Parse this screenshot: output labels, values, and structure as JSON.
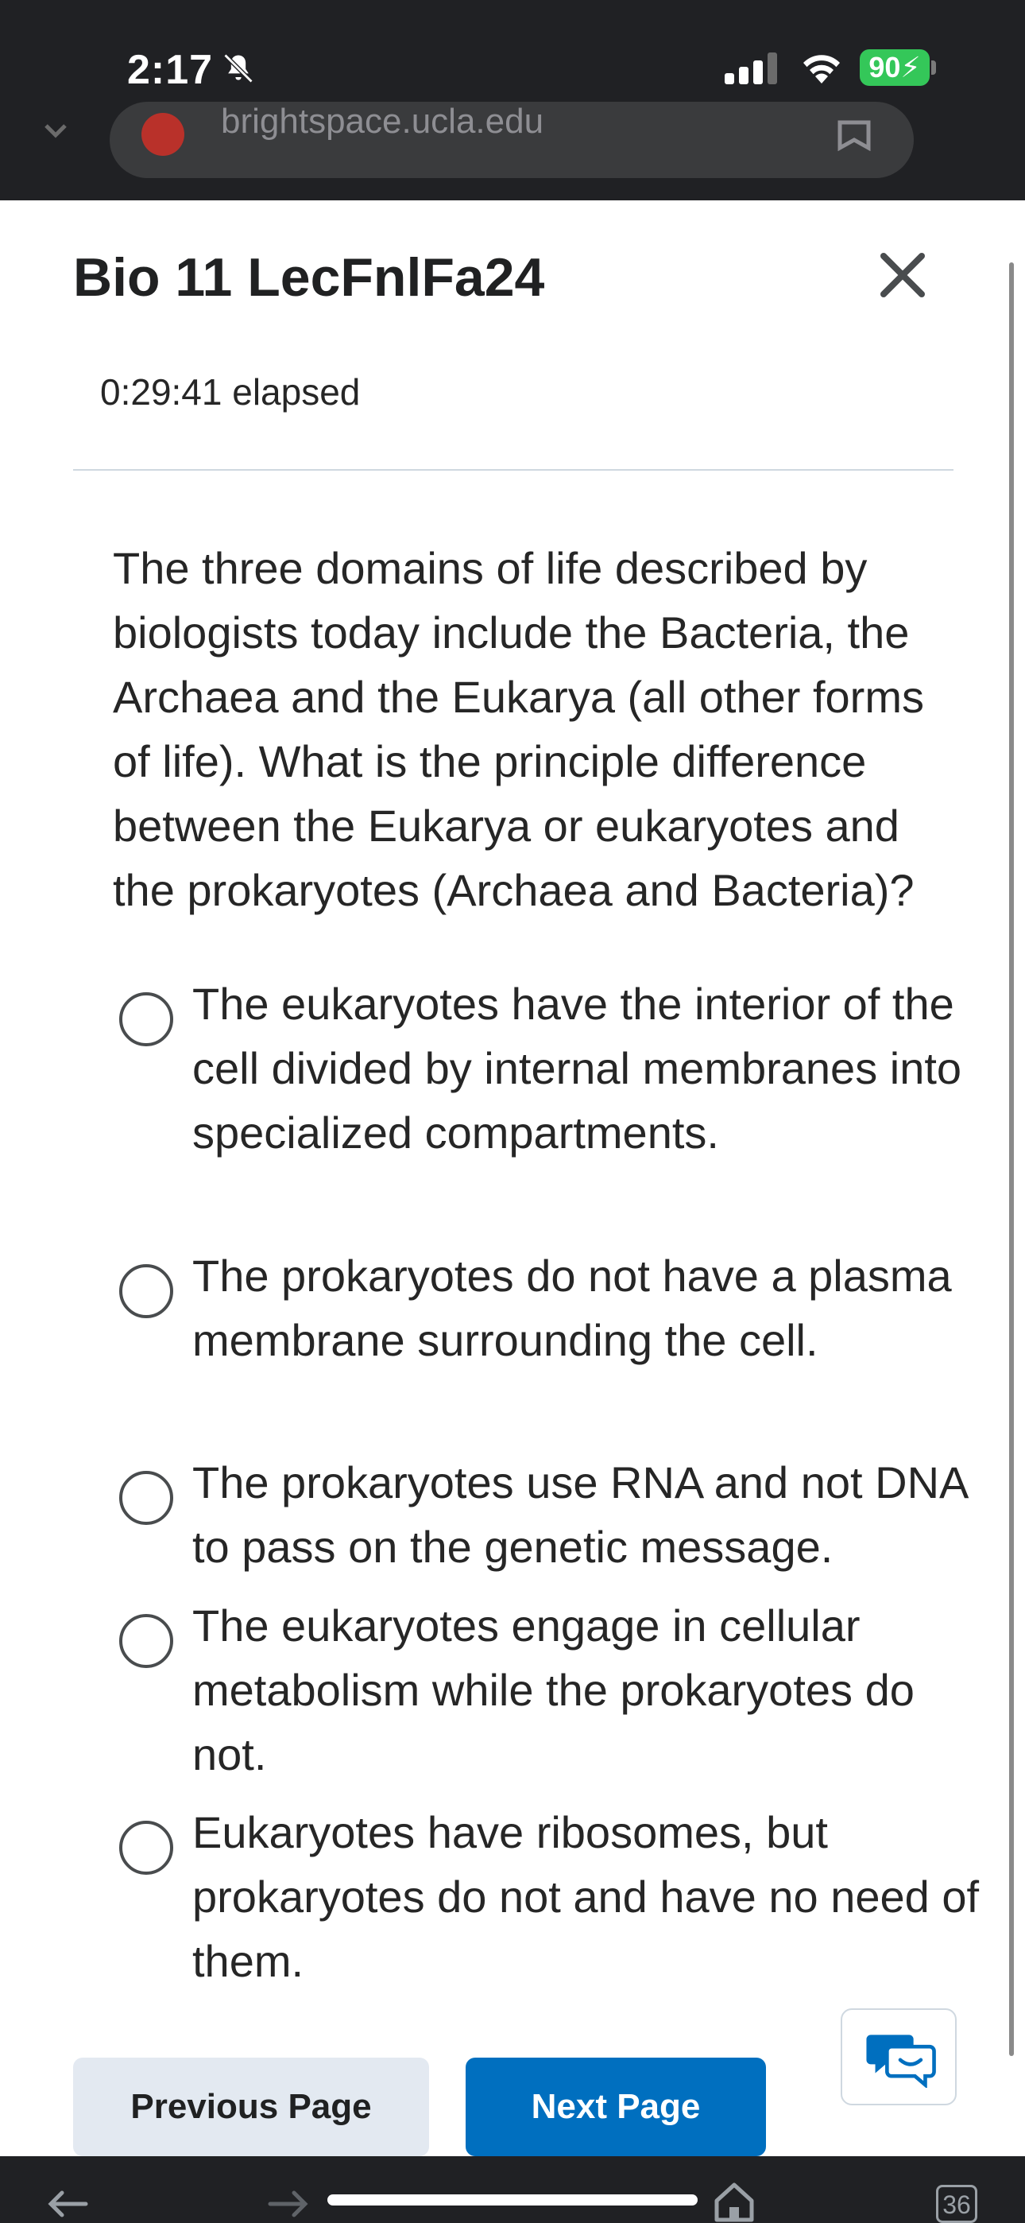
{
  "status_bar": {
    "time": "2:17",
    "battery": "90"
  },
  "browser": {
    "url": "brightspace.ucla.edu"
  },
  "quiz": {
    "title": "Bio 11 LecFnlFa24",
    "elapsed": "0:29:41 elapsed"
  },
  "question": {
    "text": "The three domains of life described by biologists today include the Bacteria, the Archaea and the Eukarya (all other forms of life). What is the principle difference between the Eukarya or eukaryotes and the prokaryotes (Archaea and Bacteria)?",
    "options": [
      {
        "label": "The eukaryotes have the interior of the cell divided by internal membranes into specialized compartments."
      },
      {
        "label": "The prokaryotes do not have a plasma membrane surrounding the cell."
      },
      {
        "label": "The prokaryotes use RNA and not DNA to pass on the genetic message."
      },
      {
        "label": "The eukaryotes engage in cellular metabolism while the prokaryotes do not."
      },
      {
        "label": "Eukaryotes have ribosomes, but prokaryotes do not and have no need of them."
      }
    ]
  },
  "footer": {
    "previous_label": "Previous Page",
    "next_label": "Next Page"
  },
  "bottom_bar": {
    "tab_count": "36"
  },
  "colors": {
    "primary": "#006fbf",
    "secondary_button": "#e3e9f1",
    "battery": "#34c759"
  },
  "icons": [
    "bell-off-icon",
    "signal-icon",
    "wifi-icon",
    "close-icon",
    "chat-icon",
    "back-arrow-icon",
    "forward-arrow-icon",
    "home-icon",
    "bookmark-icon",
    "tabs-icon"
  ]
}
